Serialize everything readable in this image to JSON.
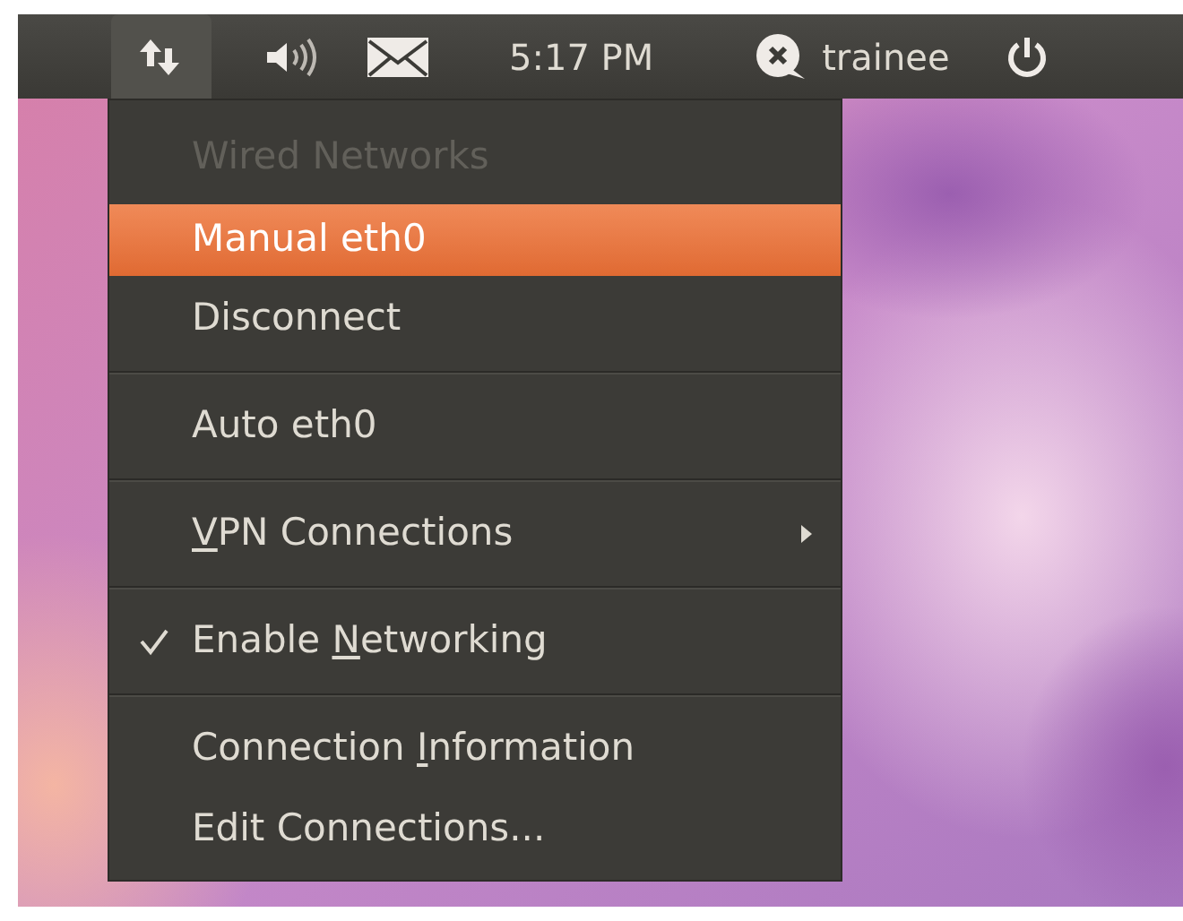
{
  "panel": {
    "indicators": [
      {
        "kind": "network",
        "selected": true
      },
      {
        "kind": "sound",
        "selected": false
      },
      {
        "kind": "mail",
        "selected": false
      },
      {
        "kind": "clock",
        "label": "5:17 PM",
        "selected": false
      },
      {
        "kind": "user",
        "label": "trainee",
        "selected": false
      },
      {
        "kind": "power",
        "selected": false
      }
    ]
  },
  "menu": {
    "items": [
      {
        "kind": "item",
        "label": "Wired Networks",
        "disabled": true,
        "selected": false,
        "checked": false,
        "submenu": false
      },
      {
        "kind": "item",
        "label": "Manual eth0",
        "disabled": false,
        "selected": true,
        "checked": false,
        "submenu": false
      },
      {
        "kind": "item",
        "label": "Disconnect",
        "disabled": false,
        "selected": false,
        "checked": false,
        "submenu": false
      },
      {
        "kind": "separator"
      },
      {
        "kind": "item",
        "label": "Auto eth0",
        "disabled": false,
        "selected": false,
        "checked": false,
        "submenu": false
      },
      {
        "kind": "separator"
      },
      {
        "kind": "item",
        "label_segments": [
          {
            "text": "V",
            "underlined": true
          },
          {
            "text": "PN Connections",
            "underlined": false
          }
        ],
        "disabled": false,
        "selected": false,
        "checked": false,
        "submenu": true
      },
      {
        "kind": "separator"
      },
      {
        "kind": "item",
        "label_segments": [
          {
            "text": "Enable ",
            "underlined": false
          },
          {
            "text": "N",
            "underlined": true
          },
          {
            "text": "etworking",
            "underlined": false
          }
        ],
        "disabled": false,
        "selected": false,
        "checked": true,
        "submenu": false
      },
      {
        "kind": "separator"
      },
      {
        "kind": "item",
        "label_segments": [
          {
            "text": "Connection ",
            "underlined": false
          },
          {
            "text": "I",
            "underlined": true
          },
          {
            "text": "nformation",
            "underlined": false
          }
        ],
        "disabled": false,
        "selected": false,
        "checked": false,
        "submenu": false
      },
      {
        "kind": "item",
        "label": "Edit Connections...",
        "disabled": false,
        "selected": false,
        "checked": false,
        "submenu": false
      }
    ]
  }
}
